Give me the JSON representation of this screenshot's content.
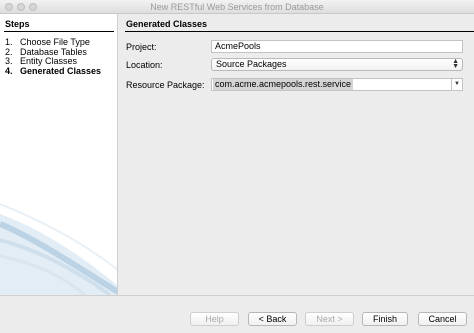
{
  "window": {
    "title": "New RESTful Web Services from Database"
  },
  "steps": {
    "title": "Steps",
    "items": [
      {
        "number": "1.",
        "label": "Choose File Type"
      },
      {
        "number": "2.",
        "label": "Database Tables"
      },
      {
        "number": "3.",
        "label": "Entity Classes"
      },
      {
        "number": "4.",
        "label": "Generated Classes"
      }
    ]
  },
  "panel": {
    "title": "Generated Classes",
    "project": {
      "label": "Project:",
      "value": "AcmePools"
    },
    "location": {
      "label": "Location:",
      "value": "Source Packages"
    },
    "resource_package": {
      "label": "Resource Package:",
      "value": "com.acme.acmepools.rest.service"
    }
  },
  "buttons": {
    "help": "Help",
    "back": "< Back",
    "next": "Next >",
    "finish": "Finish",
    "cancel": "Cancel"
  },
  "icons": {
    "location_arrows": "up-down-arrows-icon",
    "package_dropdown": "chevron-down-icon"
  },
  "colors": {
    "selection": "#d4d4d4",
    "swoosh": "#bcd3e6"
  }
}
